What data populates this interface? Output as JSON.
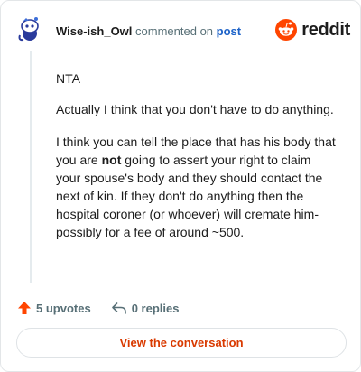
{
  "header": {
    "username": "Wise-ish_Owl",
    "action_text": "commented on",
    "post_link": "post",
    "brand": "reddit"
  },
  "comment": {
    "paragraph_1": "NTA",
    "paragraph_2": "Actually I think that you don't have to do anything.",
    "paragraph_3_part_1": "I think you can tell the place that has his body that you are ",
    "paragraph_3_bold": "not",
    "paragraph_3_part_2": " going to assert your right to claim your spouse's body and they should contact the next of kin. If they don't do anything then the hospital coroner (or whoever) will cremate him-possibly for a fee of around ~500."
  },
  "footer": {
    "upvotes": "5 upvotes",
    "replies": "0 replies"
  },
  "cta": {
    "label": "View the conversation"
  },
  "colors": {
    "brand_orange": "#ff4500",
    "cta_text": "#d93a00",
    "link_blue": "#1c62c8",
    "muted_text": "#576f76"
  },
  "icons": {
    "avatar": "snoo-avatar",
    "brand": "reddit-logo-icon",
    "upvote": "upvote-arrow-icon",
    "reply": "reply-arrow-icon"
  }
}
